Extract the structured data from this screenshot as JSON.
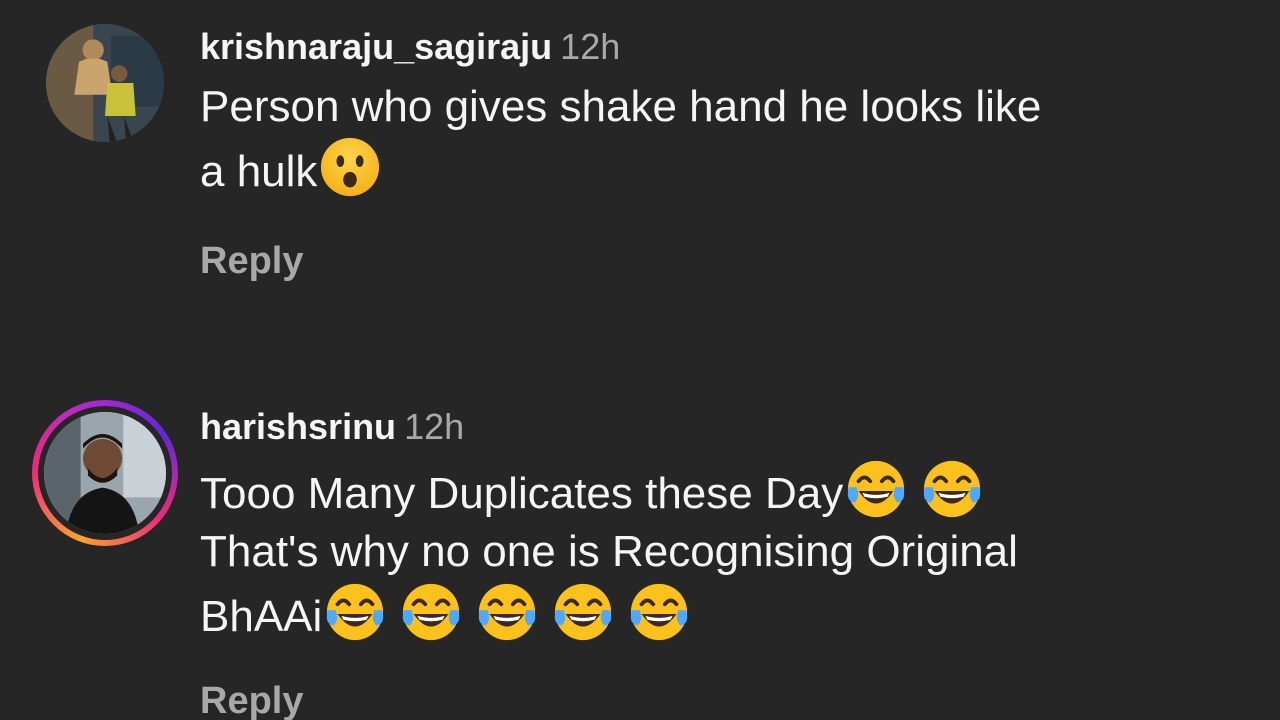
{
  "comments": [
    {
      "username": "krishnaraju_sagiraju",
      "time": "12h",
      "body_lines": [
        "Person who gives shake hand he looks like",
        "a hulk"
      ],
      "emoji_icon": "face-with-open-mouth-emoji",
      "reply_label": "Reply"
    },
    {
      "username": "harishsrinu",
      "time": "12h",
      "body_lines": [
        "Tooo Many Duplicates these Day",
        "That's why no one is Recognising Original",
        "BhAAi"
      ],
      "emoji_icon": "face-with-tears-of-joy-emoji",
      "reply_label": "Reply",
      "story_ring": true
    }
  ],
  "colors": {
    "background": "#262626",
    "primary_text": "#f5f5f5",
    "secondary_text": "#a8a8a8"
  }
}
